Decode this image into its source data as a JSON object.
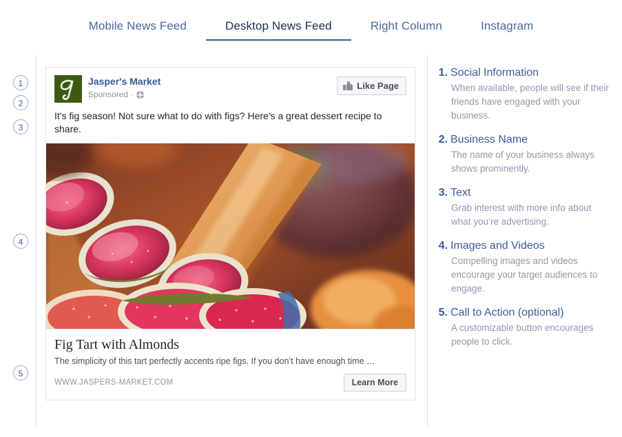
{
  "tabs": [
    {
      "label": "Mobile News Feed",
      "active": false
    },
    {
      "label": "Desktop News Feed",
      "active": true
    },
    {
      "label": "Right Column",
      "active": false
    },
    {
      "label": "Instagram",
      "active": false
    }
  ],
  "callouts": [
    {
      "number": "1"
    },
    {
      "number": "2"
    },
    {
      "number": "3"
    },
    {
      "number": "4"
    },
    {
      "number": "5"
    }
  ],
  "ad": {
    "page_name": "Jasper's Market",
    "sponsored_label": "Sponsored",
    "separator": "·",
    "like_button_label": "Like Page",
    "body_text": "It's fig season! Not sure what to do with figs? Here's a great dessert recipe to share.",
    "image_alt": "Fig tart with sliced figs and almonds on pastry",
    "link_title": "Fig Tart with Almonds",
    "link_description": "The simplicity of this tart perfectly accents ripe figs. If you don’t have enough time …",
    "link_url": "WWW.JASPERS-MARKET.COM",
    "cta_label": "Learn More"
  },
  "notes": [
    {
      "number": "1.",
      "title": "Social Information",
      "description": "When available, people will see if their friends have engaged with your business."
    },
    {
      "number": "2.",
      "title": "Business Name",
      "description": "The name of your business always shows prominently."
    },
    {
      "number": "3.",
      "title": "Text",
      "description": "Grab interest with more info about what you’re advertising."
    },
    {
      "number": "4.",
      "title": "Images and Videos",
      "description": "Compelling images and videos encourage your target audiences to engage."
    },
    {
      "number": "5.",
      "title": "Call to Action (optional)",
      "description": "A customizable button encourages people to click."
    }
  ],
  "colors": {
    "accent": "#3b5b9b",
    "link": "#3b5998",
    "muted": "#8d98ab",
    "avatar_bg": "#3d5a15",
    "tab_inactive": "#4b67a1",
    "tab_active": "#1d2d50"
  }
}
